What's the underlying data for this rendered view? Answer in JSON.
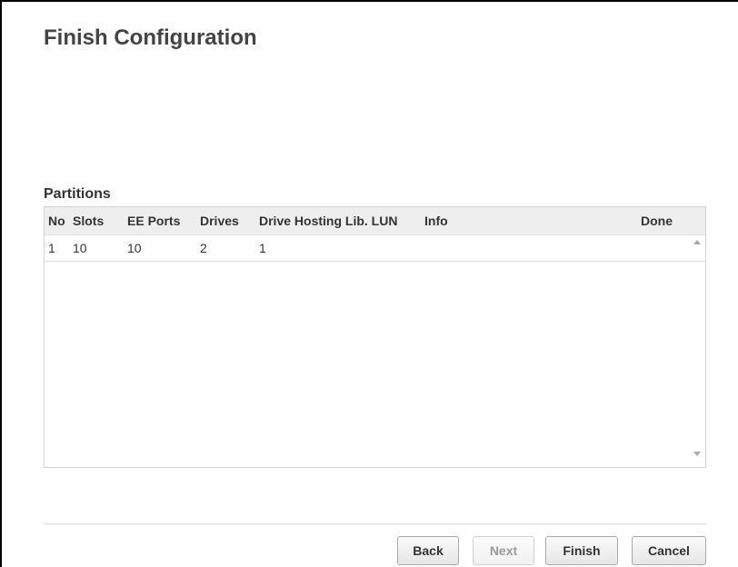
{
  "dialog": {
    "title": "Finish Configuration"
  },
  "partitions": {
    "section_title": "Partitions",
    "columns": [
      "No",
      "Slots",
      "EE Ports",
      "Drives",
      "Drive Hosting Lib. LUN",
      "Info",
      "Done"
    ],
    "rows": [
      {
        "no": "1",
        "slots": "10",
        "ee_ports": "10",
        "drives": "2",
        "lun": "1",
        "info": "",
        "done": ""
      }
    ]
  },
  "buttons": {
    "back": "Back",
    "next": "Next",
    "finish": "Finish",
    "cancel": "Cancel",
    "next_disabled": true
  },
  "icons": {
    "scroll_up": "scroll-up-arrow-icon",
    "scroll_down": "scroll-down-arrow-icon"
  }
}
